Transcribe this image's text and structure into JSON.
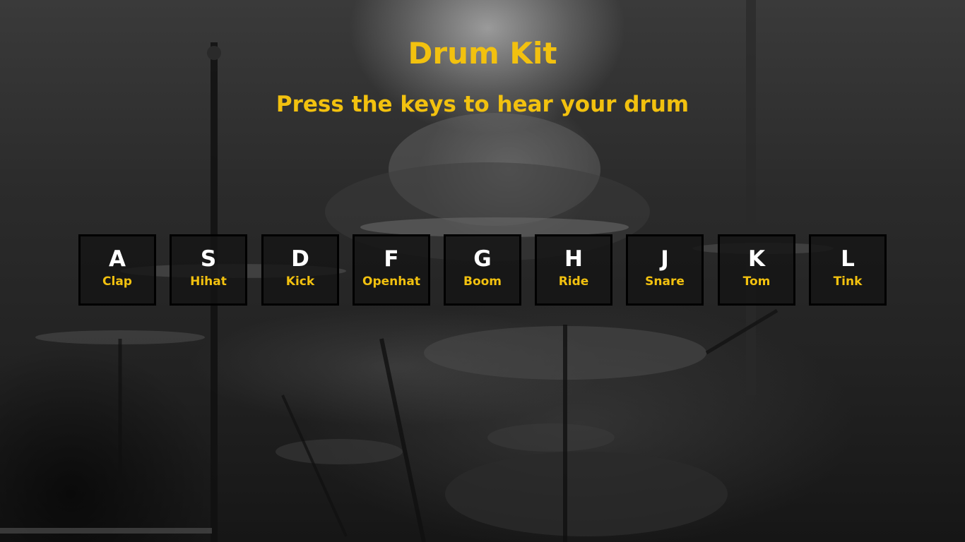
{
  "page": {
    "title": "Drum Kit",
    "subtitle": "Press the keys to hear your drum"
  },
  "keys": [
    {
      "letter": "A",
      "sound": "Clap"
    },
    {
      "letter": "S",
      "sound": "Hihat"
    },
    {
      "letter": "D",
      "sound": "Kick"
    },
    {
      "letter": "F",
      "sound": "Openhat"
    },
    {
      "letter": "G",
      "sound": "Boom"
    },
    {
      "letter": "H",
      "sound": "Ride"
    },
    {
      "letter": "J",
      "sound": "Snare"
    },
    {
      "letter": "K",
      "sound": "Tom"
    },
    {
      "letter": "L",
      "sound": "Tink"
    }
  ],
  "colors": {
    "accent": "#f2c10f",
    "key_letter": "#ffffff",
    "key_border": "#000000",
    "key_background": "#141414"
  },
  "background": {
    "description_icon": "drummer-photo-background"
  }
}
